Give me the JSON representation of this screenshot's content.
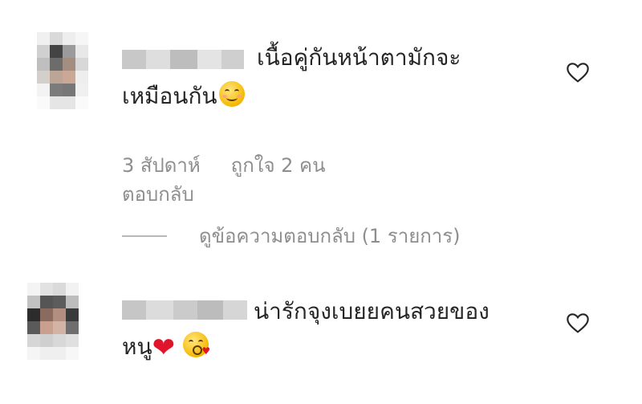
{
  "comments": [
    {
      "text_line1": "เนื้อคู่กันหน้าตามักจะ",
      "text_line2": "เหมือนกัน",
      "emoji": "smiling-face-emoji",
      "time": "3 สัปดาห์",
      "likes": "ถูกใจ 2 คน",
      "reply_label": "ตอบกลับ",
      "view_replies_label": "ดูข้อความตอบกลับ (1 รายการ)",
      "like_icon": "heart-outline-icon"
    },
    {
      "text_line1": "น่ารักจุงเบยยคนสวยของ",
      "text_line2": "หนู",
      "emoji": "red-heart-emoji, face-blowing-kiss-emoji",
      "like_icon": "heart-outline-icon"
    }
  ],
  "colors": {
    "text": "#262626",
    "muted": "#8e8e8e",
    "divider": "#b8b8b8"
  }
}
